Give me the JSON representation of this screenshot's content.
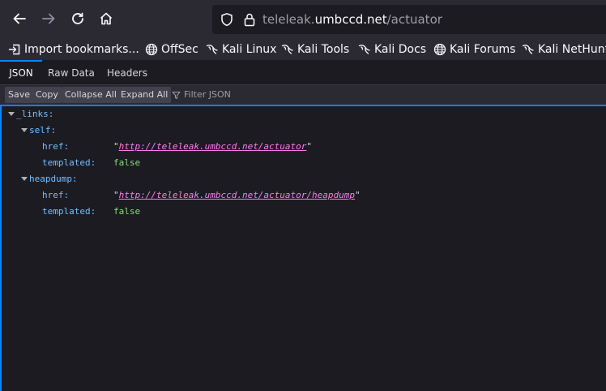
{
  "browser": {
    "url_host_prefix": "teleleak.",
    "url_host": "umbccd.net",
    "url_path": "/actuator"
  },
  "bookmarks": [
    {
      "label": "Import bookmarks...",
      "icon": "import-icon"
    },
    {
      "label": "OffSec",
      "icon": "globe-icon"
    },
    {
      "label": "Kali Linux",
      "icon": "kali-dragon-icon"
    },
    {
      "label": "Kali Tools",
      "icon": "kali-dragon-icon"
    },
    {
      "label": "Kali Docs",
      "icon": "kali-dragon-icon"
    },
    {
      "label": "Kali Forums",
      "icon": "globe-icon"
    },
    {
      "label": "Kali NetHunt",
      "icon": "kali-dragon-icon"
    }
  ],
  "viewer": {
    "tabs": [
      {
        "label": "JSON",
        "active": true
      },
      {
        "label": "Raw Data",
        "active": false
      },
      {
        "label": "Headers",
        "active": false
      }
    ],
    "buttons": {
      "save": "Save",
      "copy": "Copy",
      "collapse_all": "Collapse All",
      "expand_all": "Expand All"
    },
    "filter_placeholder": "Filter JSON"
  },
  "json": {
    "root_key": "_links:",
    "self_key": "self:",
    "self_href_key": "href:",
    "self_href_value": "http://teleleak.umbccd.net/actuator",
    "self_templated_key": "templated:",
    "self_templated_value": "false",
    "heapdump_key": "heapdump:",
    "heapdump_href_key": "href:",
    "heapdump_href_value": "http://teleleak.umbccd.net/actuator/heapdump",
    "heapdump_templated_key": "templated:",
    "heapdump_templated_value": "false",
    "quote": "\""
  },
  "colors": {
    "accent": "#0a84ff",
    "key": "#75bfff",
    "link": "#ff7de9",
    "bool": "#86de74"
  }
}
